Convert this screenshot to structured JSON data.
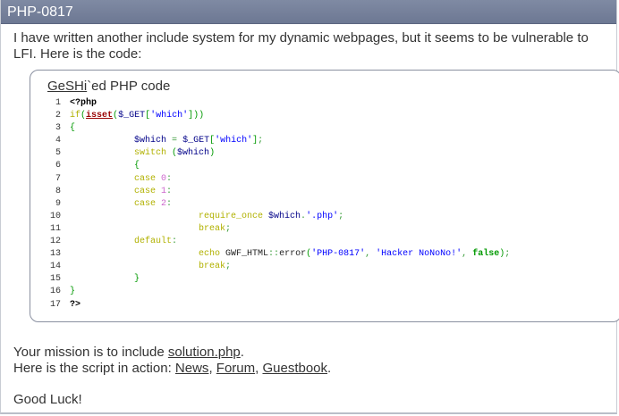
{
  "title": "PHP-0817",
  "intro": "I have written another include system for my dynamic webpages, but it seems to be vulnerable to LFI. Here is the code:",
  "code_header": {
    "link": "GeSHi",
    "suffix": "`ed PHP code"
  },
  "code": {
    "l1": "<?php",
    "l2_if": "if",
    "l2_isset": "isset",
    "l2_var": "$_GET",
    "l2_str": "'which'",
    "l4_var1": "$which",
    "l4_var2": "$_GET",
    "l4_str": "'which'",
    "l5_kw": "switch",
    "l5_var": "$which",
    "case0": "0",
    "case1": "1",
    "case2": "2",
    "case_kw": "case",
    "l10_fn": "require_once",
    "l10_var": "$which",
    "l10_str": "'.php'",
    "break": "break",
    "default": "default",
    "l13_echo": "echo",
    "l13_class": "GWF_HTML",
    "l13_method": "error",
    "l13_str1": "'PHP-0817'",
    "l13_str2": "'Hacker NoNoNo!'",
    "l13_false": "false",
    "l17": "?>"
  },
  "mission": {
    "prefix": "Your mission is to include ",
    "link": "solution.php",
    "suffix": "."
  },
  "action": {
    "prefix": "Here is the script in action: ",
    "links": [
      "News",
      "Forum",
      "Guestbook"
    ],
    "sep": ", ",
    "end": "."
  },
  "good_luck": "Good Luck!"
}
